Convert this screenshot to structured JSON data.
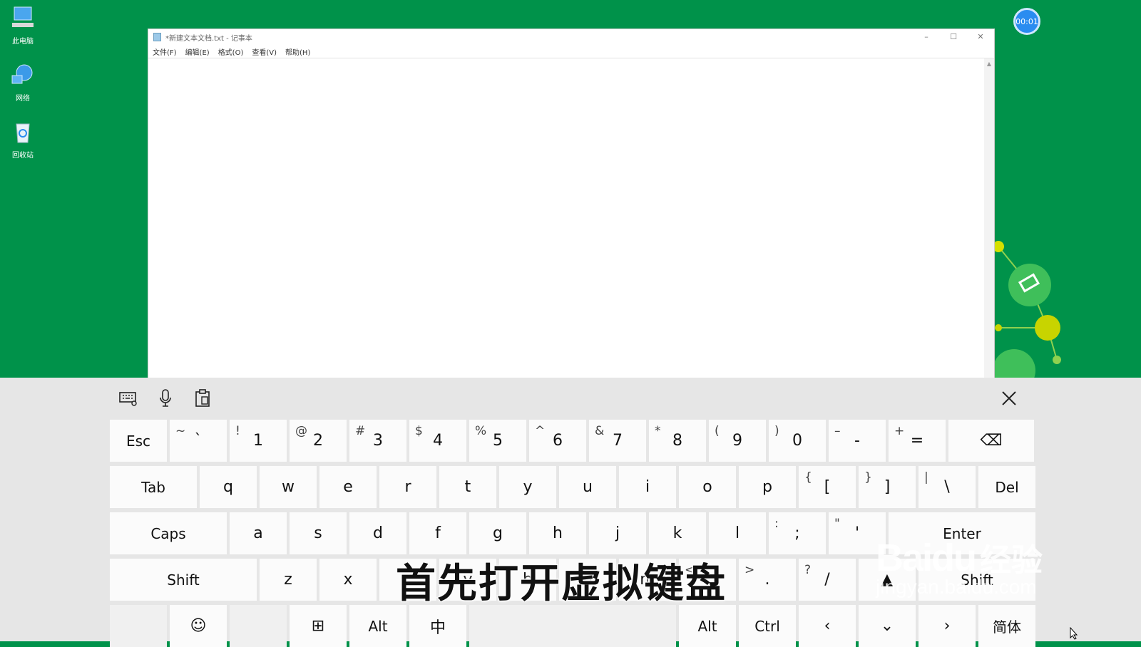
{
  "desktop": {
    "icons": [
      {
        "label": "此电脑",
        "icon": "computer-icon"
      },
      {
        "label": "网络",
        "icon": "network-icon"
      },
      {
        "label": "回收站",
        "icon": "recycle-bin-icon"
      }
    ],
    "timer": "00:01"
  },
  "notepad": {
    "title": "*新建文本文档.txt - 记事本",
    "menu": [
      "文件(F)",
      "编辑(E)",
      "格式(O)",
      "查看(V)",
      "帮助(H)"
    ],
    "controls": {
      "minimize": "–",
      "maximize": "☐",
      "close": "✕"
    }
  },
  "keyboard": {
    "tools": {
      "settings": "keyboard-settings-icon",
      "mic": "microphone-icon",
      "clipboard": "clipboard-icon"
    },
    "close": "✕",
    "row1": [
      {
        "main": "Esc",
        "shift": ""
      },
      {
        "main": "`",
        "shift": "~"
      },
      {
        "main": "1",
        "shift": "!"
      },
      {
        "main": "2",
        "shift": "@"
      },
      {
        "main": "3",
        "shift": "#"
      },
      {
        "main": "4",
        "shift": "$"
      },
      {
        "main": "5",
        "shift": "%"
      },
      {
        "main": "6",
        "shift": "^"
      },
      {
        "main": "7",
        "shift": "&"
      },
      {
        "main": "8",
        "shift": "*"
      },
      {
        "main": "9",
        "shift": "("
      },
      {
        "main": "0",
        "shift": ")"
      },
      {
        "main": "-",
        "shift": "–"
      },
      {
        "main": "=",
        "shift": "+"
      },
      {
        "main": "⌫",
        "shift": ""
      }
    ],
    "row2": [
      {
        "main": "Tab",
        "shift": ""
      },
      {
        "main": "q",
        "shift": ""
      },
      {
        "main": "w",
        "shift": ""
      },
      {
        "main": "e",
        "shift": ""
      },
      {
        "main": "r",
        "shift": ""
      },
      {
        "main": "t",
        "shift": ""
      },
      {
        "main": "y",
        "shift": ""
      },
      {
        "main": "u",
        "shift": ""
      },
      {
        "main": "i",
        "shift": ""
      },
      {
        "main": "o",
        "shift": ""
      },
      {
        "main": "p",
        "shift": ""
      },
      {
        "main": "[",
        "shift": "{"
      },
      {
        "main": "]",
        "shift": "}"
      },
      {
        "main": "\\",
        "shift": "|"
      },
      {
        "main": "Del",
        "shift": ""
      }
    ],
    "row3": [
      {
        "main": "Caps",
        "shift": ""
      },
      {
        "main": "a",
        "shift": ""
      },
      {
        "main": "s",
        "shift": ""
      },
      {
        "main": "d",
        "shift": ""
      },
      {
        "main": "f",
        "shift": ""
      },
      {
        "main": "g",
        "shift": ""
      },
      {
        "main": "h",
        "shift": ""
      },
      {
        "main": "j",
        "shift": ""
      },
      {
        "main": "k",
        "shift": ""
      },
      {
        "main": "l",
        "shift": ""
      },
      {
        "main": ";",
        "shift": ":"
      },
      {
        "main": "'",
        "shift": "\""
      },
      {
        "main": "Enter",
        "shift": ""
      }
    ],
    "row4": [
      {
        "main": "Shift",
        "shift": ""
      },
      {
        "main": "z",
        "shift": ""
      },
      {
        "main": "x",
        "shift": ""
      },
      {
        "main": "c",
        "shift": ""
      },
      {
        "main": "v",
        "shift": ""
      },
      {
        "main": "b",
        "shift": ""
      },
      {
        "main": "n",
        "shift": ""
      },
      {
        "main": "m",
        "shift": ""
      },
      {
        "main": ",",
        "shift": "<"
      },
      {
        "main": ".",
        "shift": ">"
      },
      {
        "main": "/",
        "shift": "?"
      },
      {
        "main": "▲",
        "shift": ""
      },
      {
        "main": "Shift",
        "shift": ""
      }
    ],
    "row5": [
      {
        "main": "",
        "shift": ""
      },
      {
        "main": "☺",
        "shift": ""
      },
      {
        "main": "",
        "shift": ""
      },
      {
        "main": "⊞",
        "shift": ""
      },
      {
        "main": "Alt",
        "shift": ""
      },
      {
        "main": "中",
        "shift": ""
      },
      {
        "main": "",
        "shift": ""
      },
      {
        "main": "Alt",
        "shift": ""
      },
      {
        "main": "Ctrl",
        "shift": ""
      },
      {
        "main": "‹",
        "shift": ""
      },
      {
        "main": "⌄",
        "shift": ""
      },
      {
        "main": "›",
        "shift": ""
      },
      {
        "main": "简体",
        "shift": ""
      }
    ]
  },
  "overlay": {
    "subtitle": "首先打开虚拟键盘",
    "watermark_brand": "Baidu",
    "watermark_brand_cn": "经验",
    "watermark_url": "jingyan.baidu.com"
  },
  "colors": {
    "desktop": "#00924a",
    "keyboard_bg": "#e6e6e6",
    "key": "#fbfbfb",
    "timer": "#2a8cf0"
  }
}
